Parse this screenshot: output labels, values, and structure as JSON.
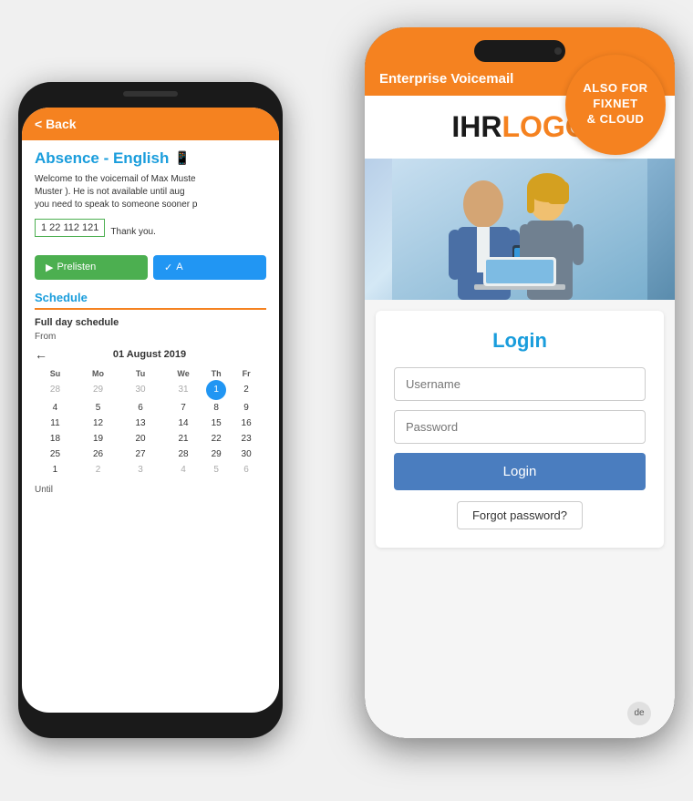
{
  "scene": {
    "badge": {
      "line1": "ALSO FOR",
      "line2": "FIXNET",
      "line3": "& CLOUD"
    }
  },
  "phone_left": {
    "header": {
      "back_label": "< Back"
    },
    "title": "Absence - English",
    "description_part1": "Welcome to the voicemail of Max Muste",
    "description_part2": "Muster ). He is not available until",
    "description_part3": "aug",
    "description_part4": "you need to speak to someone sooner p",
    "phone_number": "1 22 112 121",
    "thank_you": "Thank you.",
    "btn_prelisten": "Prelisten",
    "btn_apply": "A",
    "schedule": {
      "title": "Schedule",
      "full_day": "Full day schedule",
      "from_label": "From",
      "until_label": "Until",
      "calendar": {
        "month": "01 August 2019",
        "days_header": [
          "Su",
          "Mo",
          "Tu",
          "We",
          "Th",
          "Fr"
        ],
        "rows": [
          [
            "28",
            "29",
            "30",
            "31",
            "1",
            "2"
          ],
          [
            "4",
            "5",
            "6",
            "7",
            "8",
            "9"
          ],
          [
            "11",
            "12",
            "13",
            "14",
            "15",
            "16"
          ],
          [
            "18",
            "19",
            "20",
            "21",
            "22",
            "23"
          ],
          [
            "25",
            "26",
            "27",
            "28",
            "29",
            "30"
          ],
          [
            "1",
            "2",
            "3",
            "4",
            "5",
            "6"
          ]
        ],
        "today_row": 0,
        "today_col": 4
      }
    }
  },
  "phone_right": {
    "header": {
      "title": "Enterprise Voicemail"
    },
    "logo": {
      "ihr": "IHR",
      "logo": "LOGO"
    },
    "login": {
      "title": "Login",
      "username_placeholder": "Username",
      "password_placeholder": "Password",
      "login_btn": "Login",
      "forgot_btn": "Forgot password?",
      "lang_badge": "de"
    }
  }
}
